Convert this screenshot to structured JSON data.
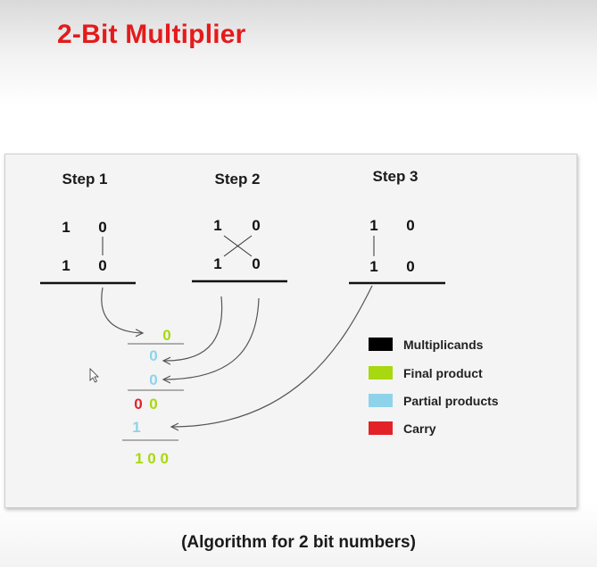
{
  "title": "2-Bit Multiplier",
  "caption": "(Algorithm for 2 bit numbers)",
  "steps": [
    {
      "label": "Step 1",
      "top": [
        "1",
        "0"
      ],
      "bottom": [
        "1",
        "0"
      ]
    },
    {
      "label": "Step 2",
      "top": [
        "1",
        "0"
      ],
      "bottom": [
        "1",
        "0"
      ]
    },
    {
      "label": "Step 3",
      "top": [
        "1",
        "0"
      ],
      "bottom": [
        "1",
        "0"
      ]
    }
  ],
  "computation": {
    "row1": "0",
    "row2": "0",
    "row3": "0",
    "row4_carry": "0",
    "row4_final": "0",
    "row5": "1",
    "result": "1 0 0"
  },
  "legend": [
    {
      "label": "Multiplicands",
      "color": "#000000"
    },
    {
      "label": "Final product",
      "color": "#a8d80f"
    },
    {
      "label": "Partial products",
      "color": "#8fd3ea"
    },
    {
      "label": "Carry",
      "color": "#e32228"
    }
  ],
  "colors": {
    "title": "#e31b1b",
    "final": "#a8d80f",
    "partial": "#8fd3ea",
    "carry": "#e32228"
  }
}
